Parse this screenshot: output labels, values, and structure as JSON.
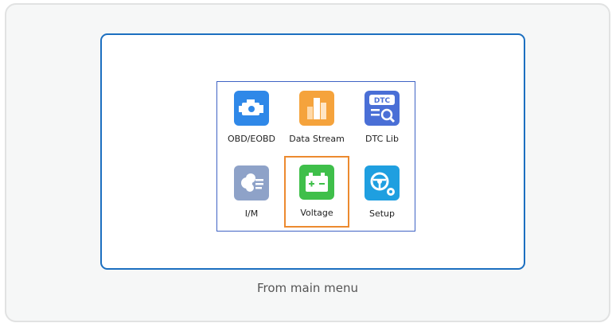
{
  "menu": {
    "items": [
      {
        "label": "OBD/EOBD",
        "icon": "engine-icon",
        "color": "#2f88e8"
      },
      {
        "label": "Data Stream",
        "icon": "bar-chart-icon",
        "color": "#f5a33c"
      },
      {
        "label": "DTC Lib",
        "icon": "dtc-search-icon",
        "color": "#4a6fd6"
      },
      {
        "label": "I/M",
        "icon": "emission-cloud-icon",
        "color": "#8ea2c8"
      },
      {
        "label": "Voltage",
        "icon": "battery-icon",
        "color": "#3fbf4a",
        "selected": true
      },
      {
        "label": "Setup",
        "icon": "steering-gear-icon",
        "color": "#1f9fe0"
      }
    ],
    "selected_border_color": "#ec8a2f"
  },
  "caption": "From main menu",
  "colors": {
    "screen_border": "#1c6fc0",
    "panel_border": "#3f63c4",
    "card_background": "#f6f7f7"
  }
}
